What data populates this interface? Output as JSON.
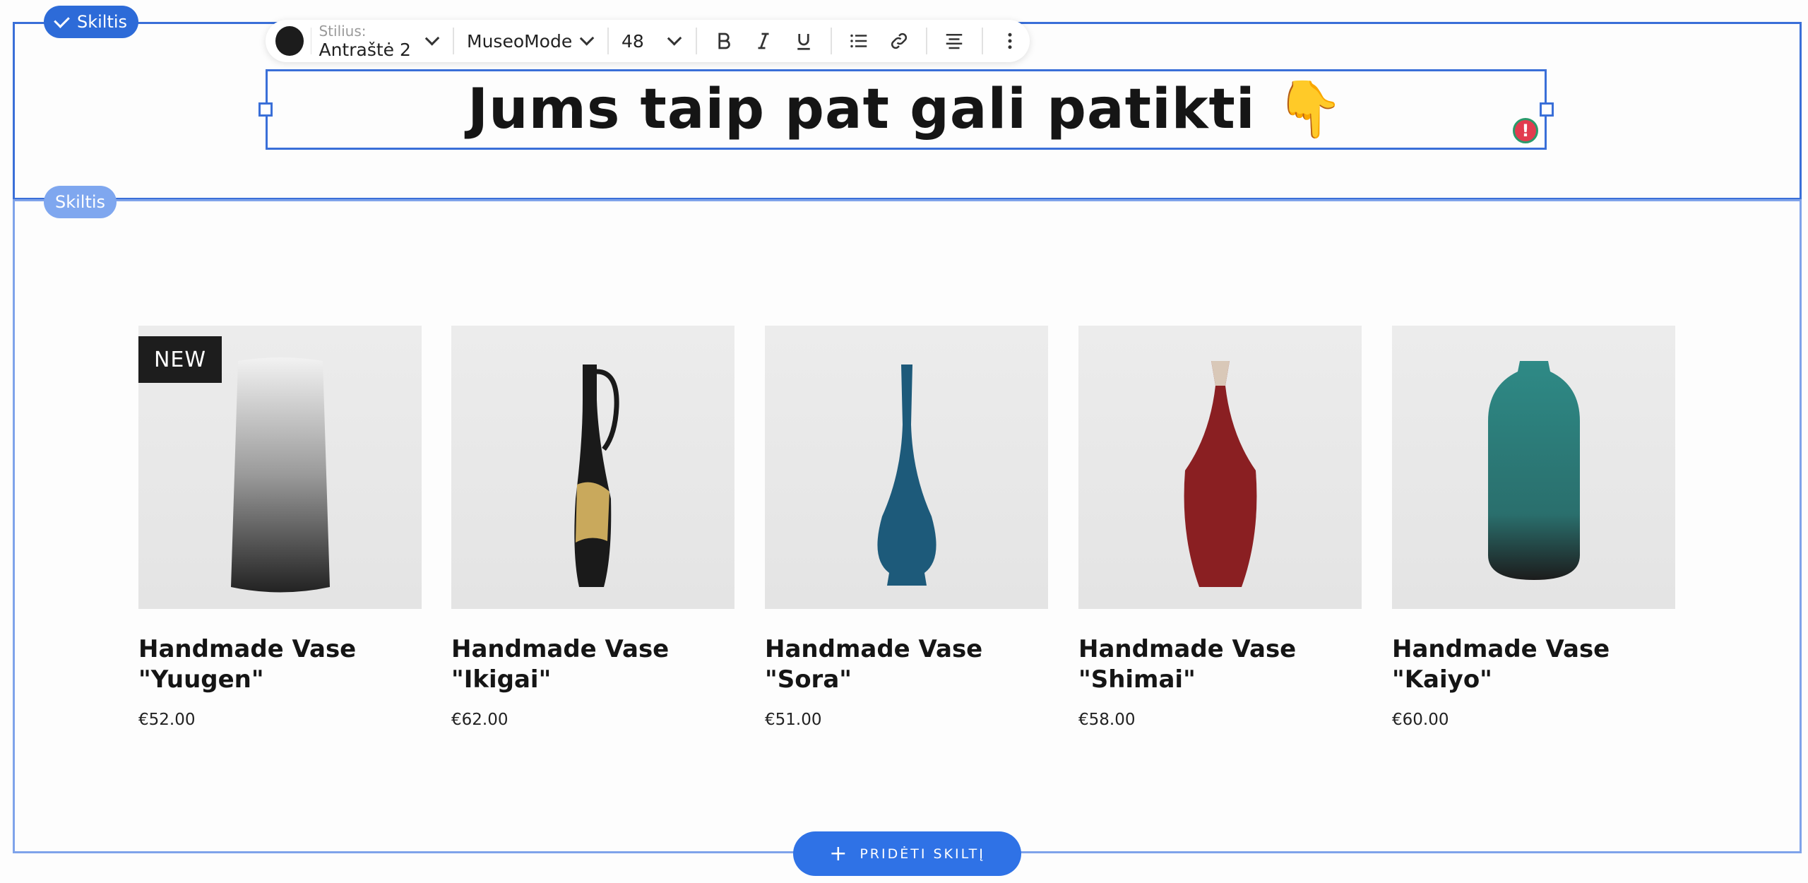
{
  "sections": {
    "active_badge": "Skiltis",
    "secondary_badge": "Skiltis"
  },
  "toolbar": {
    "color_swatch": "#1c1c1c",
    "style_label": "Stilius:",
    "style_value": "Antraštė 2",
    "font_value": "MuseoMode...",
    "size_value": "48",
    "buttons": [
      "bold-icon",
      "italic-icon",
      "underline-icon",
      "list-icon",
      "link-icon",
      "align-center-icon",
      "more-vertical-icon"
    ]
  },
  "heading": {
    "text": "Jums taip pat gali patikti",
    "emoji": "👇"
  },
  "products": [
    {
      "name": "Handmade Vase \"Yuugen\"",
      "price": "€52.00",
      "badge": "NEW",
      "color": "#6b6b6b"
    },
    {
      "name": "Handmade Vase \"Ikigai\"",
      "price": "€62.00",
      "badge": "",
      "color": "#1a1a1a"
    },
    {
      "name": "Handmade Vase \"Sora\"",
      "price": "€51.00",
      "badge": "",
      "color": "#1d5a7a"
    },
    {
      "name": "Handmade Vase \"Shimai\"",
      "price": "€58.00",
      "badge": "",
      "color": "#8a1f22"
    },
    {
      "name": "Handmade Vase \"Kaiyo\"",
      "price": "€60.00",
      "badge": "",
      "color": "#2a7a78"
    }
  ],
  "add_section": {
    "label": "PRIDĖTI SKILTĮ"
  },
  "colors": {
    "selection": "#3a6fd8",
    "accent": "#2f72e6",
    "alert": "#e23b4f"
  }
}
